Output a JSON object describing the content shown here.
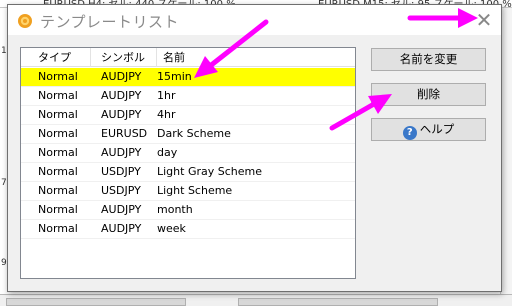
{
  "background": {
    "chart_header_left": "EURUSD,H4: セル: 440 スケール: 100 %",
    "chart_header_right": "EURUSD,M15: セル: 95 スケール: 100 %",
    "left_marks": [
      "1",
      "7",
      "9."
    ]
  },
  "dialog": {
    "title": "テンプレートリスト",
    "close_glyph": "✕"
  },
  "list": {
    "columns": [
      "タイプ",
      "シンボル",
      "名前"
    ],
    "rows": [
      {
        "type": "Normal",
        "symbol": "AUDJPY",
        "name": "15min",
        "selected": true
      },
      {
        "type": "Normal",
        "symbol": "AUDJPY",
        "name": "1hr",
        "selected": false
      },
      {
        "type": "Normal",
        "symbol": "AUDJPY",
        "name": "4hr",
        "selected": false
      },
      {
        "type": "Normal",
        "symbol": "EURUSD",
        "name": "Dark Scheme",
        "selected": false
      },
      {
        "type": "Normal",
        "symbol": "AUDJPY",
        "name": "day",
        "selected": false
      },
      {
        "type": "Normal",
        "symbol": "USDJPY",
        "name": "Light Gray Scheme",
        "selected": false
      },
      {
        "type": "Normal",
        "symbol": "USDJPY",
        "name": "Light Scheme",
        "selected": false
      },
      {
        "type": "Normal",
        "symbol": "AUDJPY",
        "name": "month",
        "selected": false
      },
      {
        "type": "Normal",
        "symbol": "AUDJPY",
        "name": "week",
        "selected": false
      }
    ]
  },
  "buttons": {
    "rename": "名前を変更",
    "delete": "削除",
    "help": "ヘルプ"
  },
  "icons": {
    "title": "gear-icon",
    "help": "question-mark-icon"
  },
  "colors": {
    "selection": "#ffff00",
    "annotation_arrow": "#ff00ff"
  }
}
